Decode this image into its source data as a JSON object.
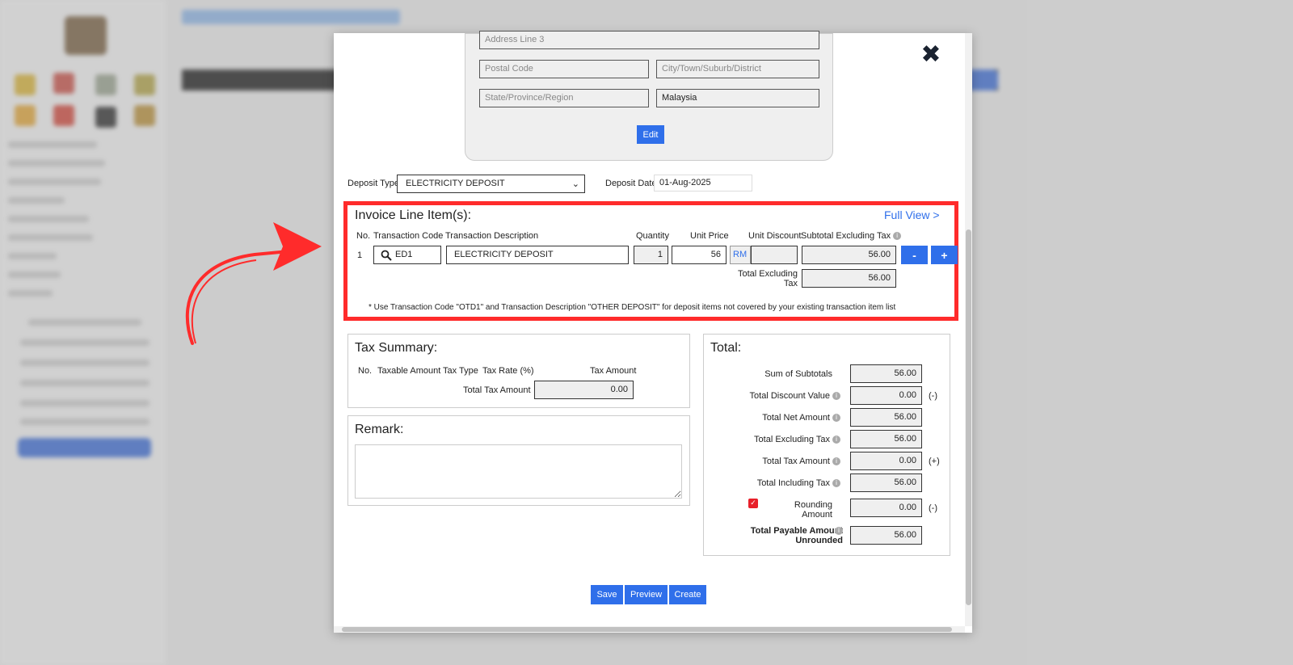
{
  "address": {
    "line3_placeholder": "Address Line 3",
    "postal_placeholder": "Postal Code",
    "city_placeholder": "City/Town/Suburb/District",
    "state_placeholder": "State/Province/Region",
    "country": "Malaysia",
    "edit_label": "Edit"
  },
  "deposit": {
    "type_label": "Deposit Type",
    "type_value": "ELECTRICITY DEPOSIT",
    "date_label": "Deposit Date",
    "date_value": "01-Aug-2025"
  },
  "line_items": {
    "title": "Invoice Line Item(s):",
    "full_view": "Full View >",
    "headers": {
      "no": "No.",
      "code": "Transaction Code",
      "desc": "Transaction Description",
      "qty": "Quantity",
      "price": "Unit Price",
      "discount": "Unit Discount",
      "subtotal": "Subtotal Excluding Tax"
    },
    "rows": [
      {
        "no": "1",
        "code": "ED1",
        "desc": "ELECTRICITY DEPOSIT",
        "qty": "1",
        "price": "56",
        "currency": "RM",
        "discount": "",
        "subtotal": "56.00"
      }
    ],
    "minus_label": "-",
    "plus_label": "+",
    "total_label": "Total Excluding Tax",
    "total_value": "56.00",
    "note": "* Use Transaction Code \"OTD1\" and Transaction Description \"OTHER DEPOSIT\" for deposit items not covered by your existing transaction item list"
  },
  "tax_summary": {
    "title": "Tax Summary:",
    "headers": {
      "no": "No.",
      "taxable": "Taxable Amount",
      "type": "Tax Type",
      "rate": "Tax Rate (%)",
      "amount": "Tax Amount"
    },
    "total_label": "Total Tax Amount",
    "total_value": "0.00"
  },
  "remark": {
    "title": "Remark:",
    "value": ""
  },
  "totals": {
    "title": "Total:",
    "rows": [
      {
        "label": "Sum of Subtotals",
        "value": "56.00",
        "suffix": ""
      },
      {
        "label": "Total Discount Value",
        "value": "0.00",
        "suffix": "(-)"
      },
      {
        "label": "Total Net Amount",
        "value": "56.00",
        "suffix": ""
      },
      {
        "label": "Total Excluding Tax",
        "value": "56.00",
        "suffix": ""
      },
      {
        "label": "Total Tax Amount",
        "value": "0.00",
        "suffix": "(+)"
      },
      {
        "label": "Total Including Tax",
        "value": "56.00",
        "suffix": ""
      }
    ],
    "rounding_label": "Rounding Amount",
    "rounding_value": "0.00",
    "rounding_suffix": "(-)",
    "rounding_checked": true,
    "payable_label": "Total Payable Amount Unrounded",
    "payable_value": "56.00"
  },
  "actions": {
    "save": "Save",
    "preview": "Preview",
    "create": "Create"
  },
  "close_icon": "close-icon",
  "colors": {
    "accent": "#2f6fea",
    "highlight": "#ff2b2b",
    "link": "#2f6fea"
  }
}
